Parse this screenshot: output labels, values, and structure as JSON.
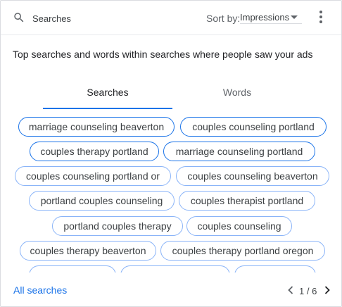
{
  "header": {
    "search_label": "Searches",
    "sort_by_label": "Sort by:",
    "sort_value": "Impressions",
    "icons": [
      "search-icon",
      "chevron-down-icon",
      "more-vert-icon"
    ]
  },
  "description": "Top searches and words within searches where people saw your ads",
  "tabs": [
    {
      "label": "Searches",
      "active": true
    },
    {
      "label": "Words",
      "active": false
    }
  ],
  "chips": [
    {
      "label": "marriage counseling beaverton"
    },
    {
      "label": "couples counseling portland"
    },
    {
      "label": "couples therapy portland"
    },
    {
      "label": "marriage counseling portland"
    },
    {
      "label": "couples counseling portland or"
    },
    {
      "label": "couples counseling beaverton"
    },
    {
      "label": "portland couples counseling"
    },
    {
      "label": "couples therapist portland"
    },
    {
      "label": "portland couples therapy"
    },
    {
      "label": "couples counseling"
    },
    {
      "label": "couples therapy beaverton"
    },
    {
      "label": "couples therapy portland oregon"
    },
    {
      "label": ""
    },
    {
      "label": ""
    },
    {
      "label": ""
    }
  ],
  "footer": {
    "all_searches": "All searches",
    "page": "1 / 6"
  },
  "colors": {
    "accent": "#1a73e8",
    "chip_border": "#8ab4f8"
  }
}
